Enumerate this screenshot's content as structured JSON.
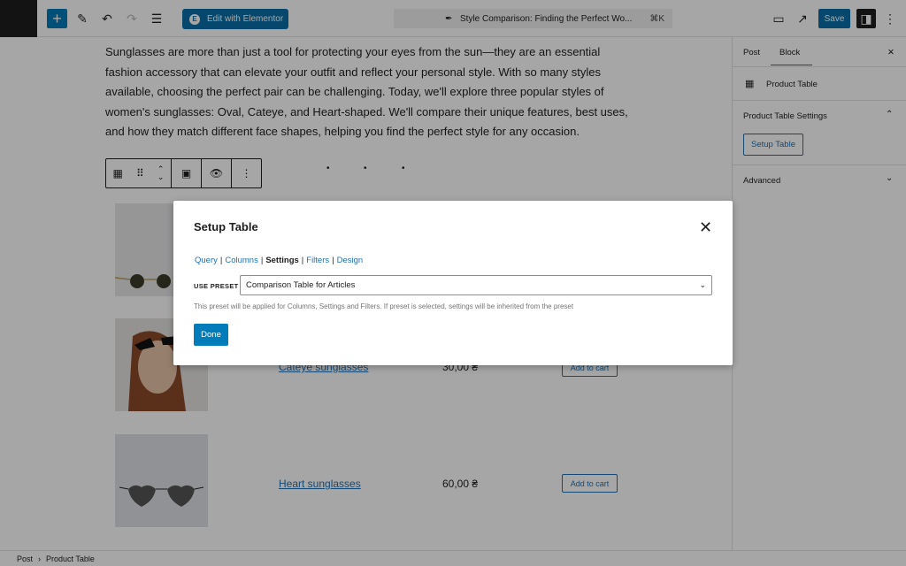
{
  "topbar": {
    "elementor_label": "Edit with Elementor",
    "doc_title": "Style Comparison: Finding the Perfect Wo...",
    "shortcut": "⌘K",
    "save_label": "Save"
  },
  "content": {
    "paragraph": "Sunglasses are more than just a tool for protecting your eyes from the sun—they are an essential fashion accessory that can elevate your outfit and reflect your personal style. With so many styles available, choosing the perfect pair can be challenging. Today, we'll explore three popular styles of women's sunglasses: Oval, Cateye, and Heart-shaped. We'll compare their unique features, best uses, and how they match different face shapes, helping you find the perfect style for any occasion.",
    "products": [
      {
        "name": "Cateye sunglasses",
        "price": "30,00 ₴",
        "cart": "Add to cart"
      },
      {
        "name": "Heart sunglasses",
        "price": "60,00 ₴",
        "cart": "Add to cart"
      }
    ]
  },
  "sidebar": {
    "tabs": [
      "Post",
      "Block"
    ],
    "active_tab": "Block",
    "block_name": "Product Table",
    "section_title": "Product Table Settings",
    "setup_button": "Setup Table",
    "advanced": "Advanced"
  },
  "statusbar": {
    "crumbs": [
      "Post",
      "Product Table"
    ]
  },
  "modal": {
    "title": "Setup Table",
    "tabs": [
      "Query",
      "Columns",
      "Settings",
      "Filters",
      "Design"
    ],
    "active_tab": "Settings",
    "preset_label": "USE PRESET",
    "preset_value": "Comparison Table for Articles",
    "help": "This preset will be applied for Columns, Settings and Filters. If preset is selected, settings will be inherited from the preset",
    "done": "Done"
  },
  "colors": {
    "accent": "#007cba",
    "link": "#2271b1"
  }
}
